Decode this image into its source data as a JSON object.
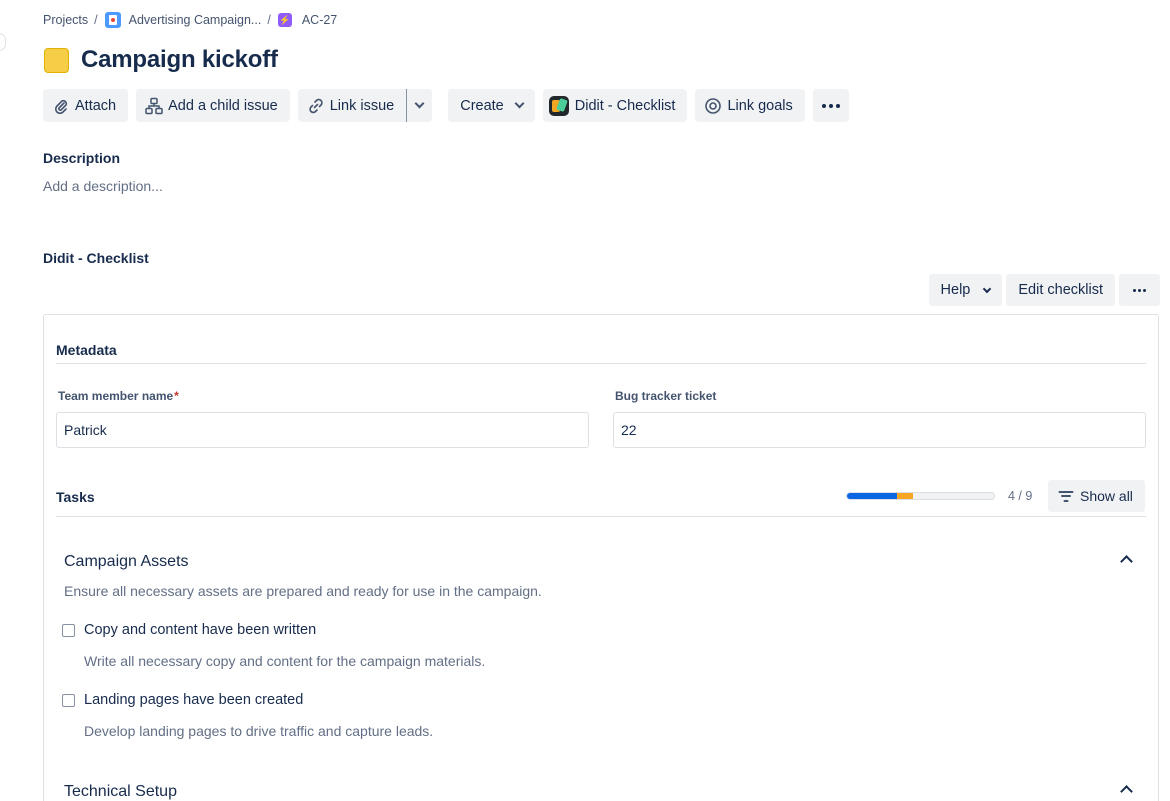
{
  "breadcrumb": {
    "projects": "Projects",
    "project": "Advertising Campaign...",
    "issue_key": "AC-27",
    "separator": "/"
  },
  "issue": {
    "title": "Campaign kickoff",
    "type_color": "#f5cd47"
  },
  "toolbar": {
    "attach": "Attach",
    "add_child": "Add a child issue",
    "link_issue": "Link issue",
    "create": "Create",
    "didit": "Didit - Checklist",
    "link_goals": "Link goals",
    "icons": {
      "attach": "paperclip-icon",
      "add_child": "hierarchy-icon",
      "link_issue": "link-icon",
      "link_goals": "target-icon",
      "more": "more-horizontal-icon"
    }
  },
  "description": {
    "label": "Description",
    "placeholder": "Add a description..."
  },
  "checklist": {
    "label": "Didit - Checklist",
    "help": "Help",
    "edit": "Edit checklist",
    "metadata": {
      "title": "Metadata",
      "fields": [
        {
          "label": "Team member name",
          "required_mark": "*",
          "value": "Patrick"
        },
        {
          "label": "Bug tracker ticket",
          "value": "22"
        }
      ]
    },
    "tasks": {
      "title": "Tasks",
      "progress": {
        "done_fraction": 0.34,
        "warn_fraction": 0.11,
        "count": "4 / 9",
        "done_color": "#0c66e4",
        "warn_color": "#f5a623"
      },
      "show_all": "Show all",
      "groups": [
        {
          "title": "Campaign Assets",
          "description": "Ensure all necessary assets are prepared and ready for use in the campaign.",
          "items": [
            {
              "label": "Copy and content have been written",
              "description": "Write all necessary copy and content for the campaign materials.",
              "checked": false
            },
            {
              "label": "Landing pages have been created",
              "description": "Develop landing pages to drive traffic and capture leads.",
              "checked": false
            }
          ]
        },
        {
          "title": "Technical Setup"
        }
      ]
    }
  }
}
